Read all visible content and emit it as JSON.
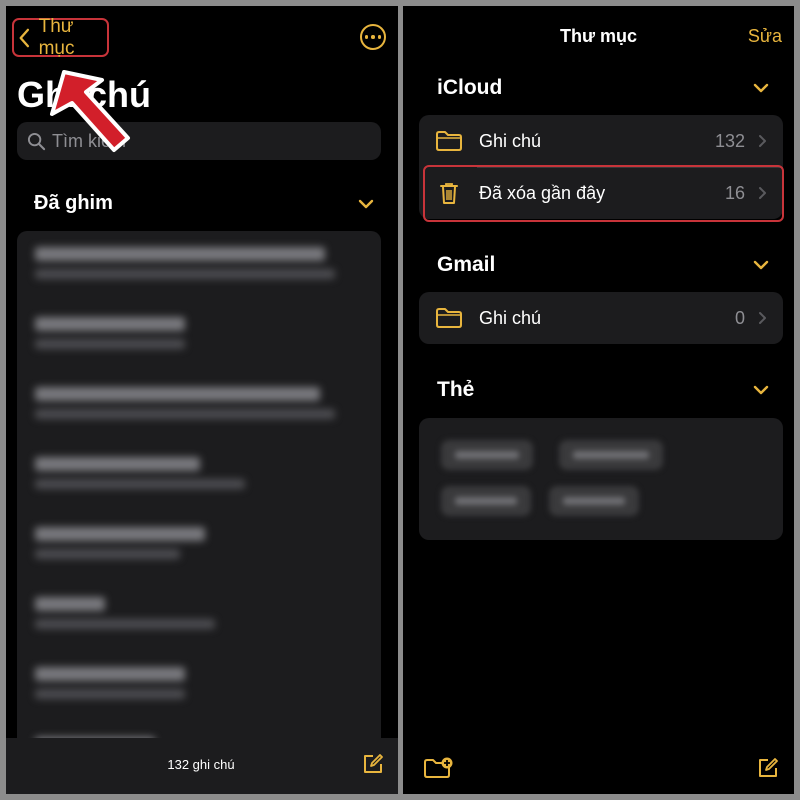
{
  "left": {
    "back_label": "Thư mục",
    "big_title": "Ghi chú",
    "search_placeholder": "Tìm kiếm",
    "pinned_section": "Đã ghim",
    "note_count": "132 ghi chú"
  },
  "right": {
    "title": "Thư mục",
    "edit_label": "Sửa",
    "sections": [
      {
        "name": "iCloud",
        "rows": [
          {
            "label": "Ghi chú",
            "count": "132",
            "icon": "folder-icon"
          },
          {
            "label": "Đã xóa gần đây",
            "count": "16",
            "icon": "trash-icon"
          }
        ]
      },
      {
        "name": "Gmail",
        "rows": [
          {
            "label": "Ghi chú",
            "count": "0",
            "icon": "folder-icon"
          }
        ]
      },
      {
        "name": "Thẻ",
        "rows": []
      }
    ]
  },
  "colors": {
    "accent": "#e8b53e",
    "highlight": "#c8343a",
    "background": "#000000",
    "cell": "#1c1c1e"
  }
}
